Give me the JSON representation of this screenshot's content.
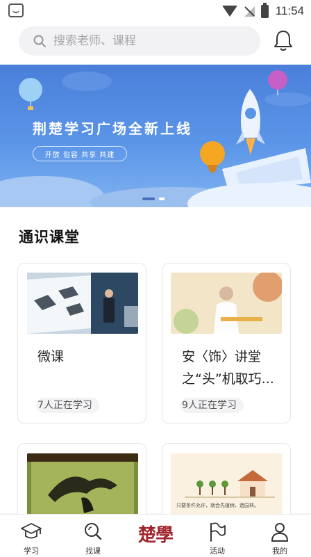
{
  "status_bar": {
    "time": "11:54",
    "icons": [
      "app-notification-icon",
      "wifi-icon",
      "no-signal-icon",
      "battery-charging-icon"
    ]
  },
  "search": {
    "placeholder": "搜索老师、课程",
    "icon": "search-icon"
  },
  "header": {
    "bell_icon": "bell-icon"
  },
  "banner": {
    "title": "荆楚学习广场全新上线",
    "tags": "开放 包容 共享 共建",
    "page_count": 2,
    "active_page": 2
  },
  "section": {
    "title": "通识课堂"
  },
  "courses": [
    {
      "title": "微课",
      "learners": "7人正在学习"
    },
    {
      "title": "安〈饰〉讲堂之“头”机取巧...",
      "learners": "9人正在学习"
    },
    {
      "title": "",
      "learners": ""
    },
    {
      "title": "",
      "caption": "只要条件允许，就会先植树、造园林。"
    }
  ],
  "bottom_nav": {
    "items": [
      {
        "label": "学习",
        "icon": "graduation-cap-icon"
      },
      {
        "label": "找课",
        "icon": "search-course-icon"
      },
      {
        "label": "楚學",
        "icon": "chuxue-logo"
      },
      {
        "label": "活动",
        "icon": "flag-icon"
      },
      {
        "label": "我的",
        "icon": "person-icon"
      }
    ]
  },
  "colors": {
    "brand_red": "#a0242c",
    "banner_blue": "#4a7fd9"
  }
}
